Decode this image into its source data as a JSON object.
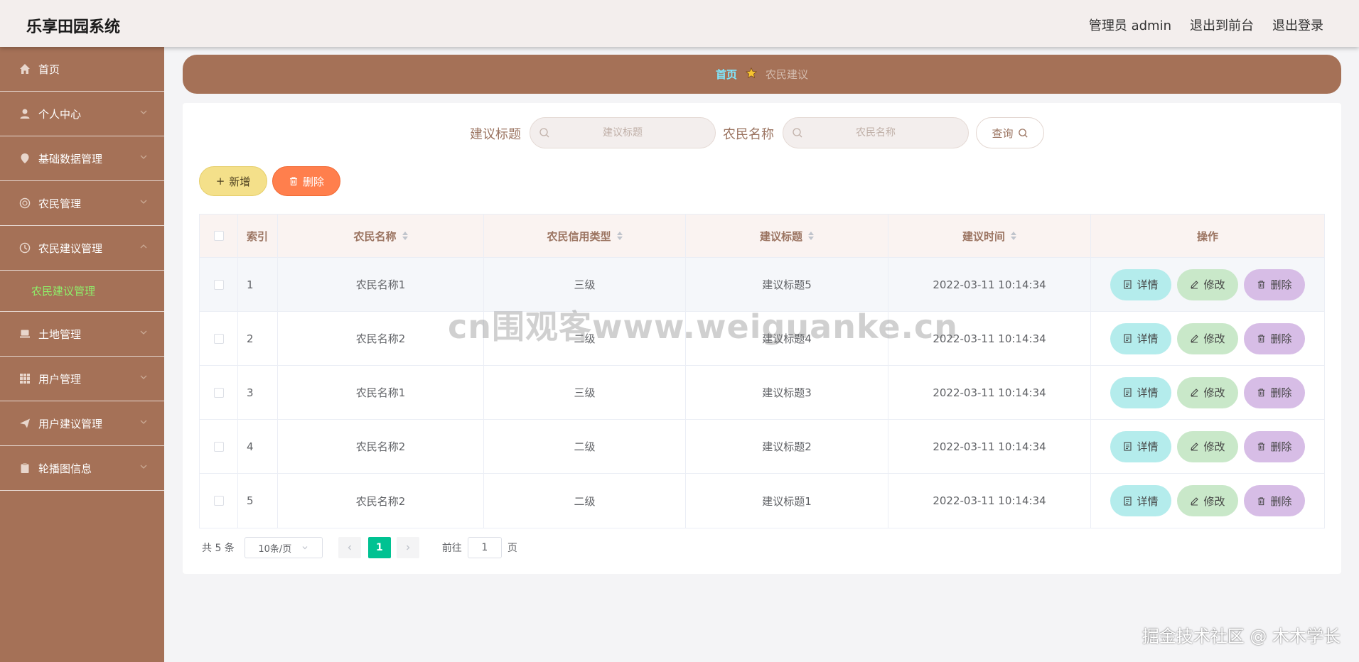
{
  "app": {
    "title": "乐享田园系统"
  },
  "header": {
    "links": [
      "管理员 admin",
      "退出到前台",
      "退出登录"
    ]
  },
  "sidebar": {
    "items": [
      {
        "label": "首页",
        "icon": "home-icon"
      },
      {
        "label": "个人中心",
        "icon": "user-icon"
      },
      {
        "label": "基础数据管理",
        "icon": "location-icon"
      },
      {
        "label": "农民管理",
        "icon": "globe-icon"
      },
      {
        "label": "农民建议管理",
        "icon": "clock-icon"
      },
      {
        "label": "土地管理",
        "icon": "laptop-icon"
      },
      {
        "label": "用户管理",
        "icon": "grid-icon"
      },
      {
        "label": "用户建议管理",
        "icon": "send-icon"
      },
      {
        "label": "轮播图信息",
        "icon": "clipboard-icon"
      }
    ],
    "active_sub": "农民建议管理"
  },
  "breadcrumb": {
    "home": "首页",
    "current": "农民建议"
  },
  "search": {
    "title_label": "建议标题",
    "title_placeholder": "建议标题",
    "farmer_label": "农民名称",
    "farmer_placeholder": "农民名称",
    "query_label": "查询"
  },
  "toolbar": {
    "add_label": "新增",
    "delete_label": "删除"
  },
  "table": {
    "headers": [
      "索引",
      "农民名称",
      "农民信用类型",
      "建议标题",
      "建议时间",
      "操作"
    ],
    "rows": [
      {
        "index": "1",
        "farmer": "农民名称1",
        "credit": "三级",
        "title": "建议标题5",
        "time": "2022-03-11 10:14:34"
      },
      {
        "index": "2",
        "farmer": "农民名称2",
        "credit": "二级",
        "title": "建议标题4",
        "time": "2022-03-11 10:14:34"
      },
      {
        "index": "3",
        "farmer": "农民名称1",
        "credit": "三级",
        "title": "建议标题3",
        "time": "2022-03-11 10:14:34"
      },
      {
        "index": "4",
        "farmer": "农民名称2",
        "credit": "二级",
        "title": "建议标题2",
        "time": "2022-03-11 10:14:34"
      },
      {
        "index": "5",
        "farmer": "农民名称2",
        "credit": "二级",
        "title": "建议标题1",
        "time": "2022-03-11 10:14:34"
      }
    ],
    "actions": {
      "detail": "详情",
      "edit": "修改",
      "delete": "删除"
    }
  },
  "pagination": {
    "total": "共 5 条",
    "page_size": "10条/页",
    "current_page": "1",
    "goto_label": "前往",
    "goto_value": "1",
    "page_suffix": "页"
  },
  "watermarks": {
    "center": "cn围观客www.weiguanke.cn",
    "corner": "掘金技术社区 @ 木木学长"
  },
  "colors": {
    "sidebar": "#a57157",
    "header": "#f3eeed",
    "active_submenu": "#8ef06a",
    "pager_active": "#00c292",
    "add_button": "#f4e08a",
    "delete_button": "#ff7f4d"
  }
}
